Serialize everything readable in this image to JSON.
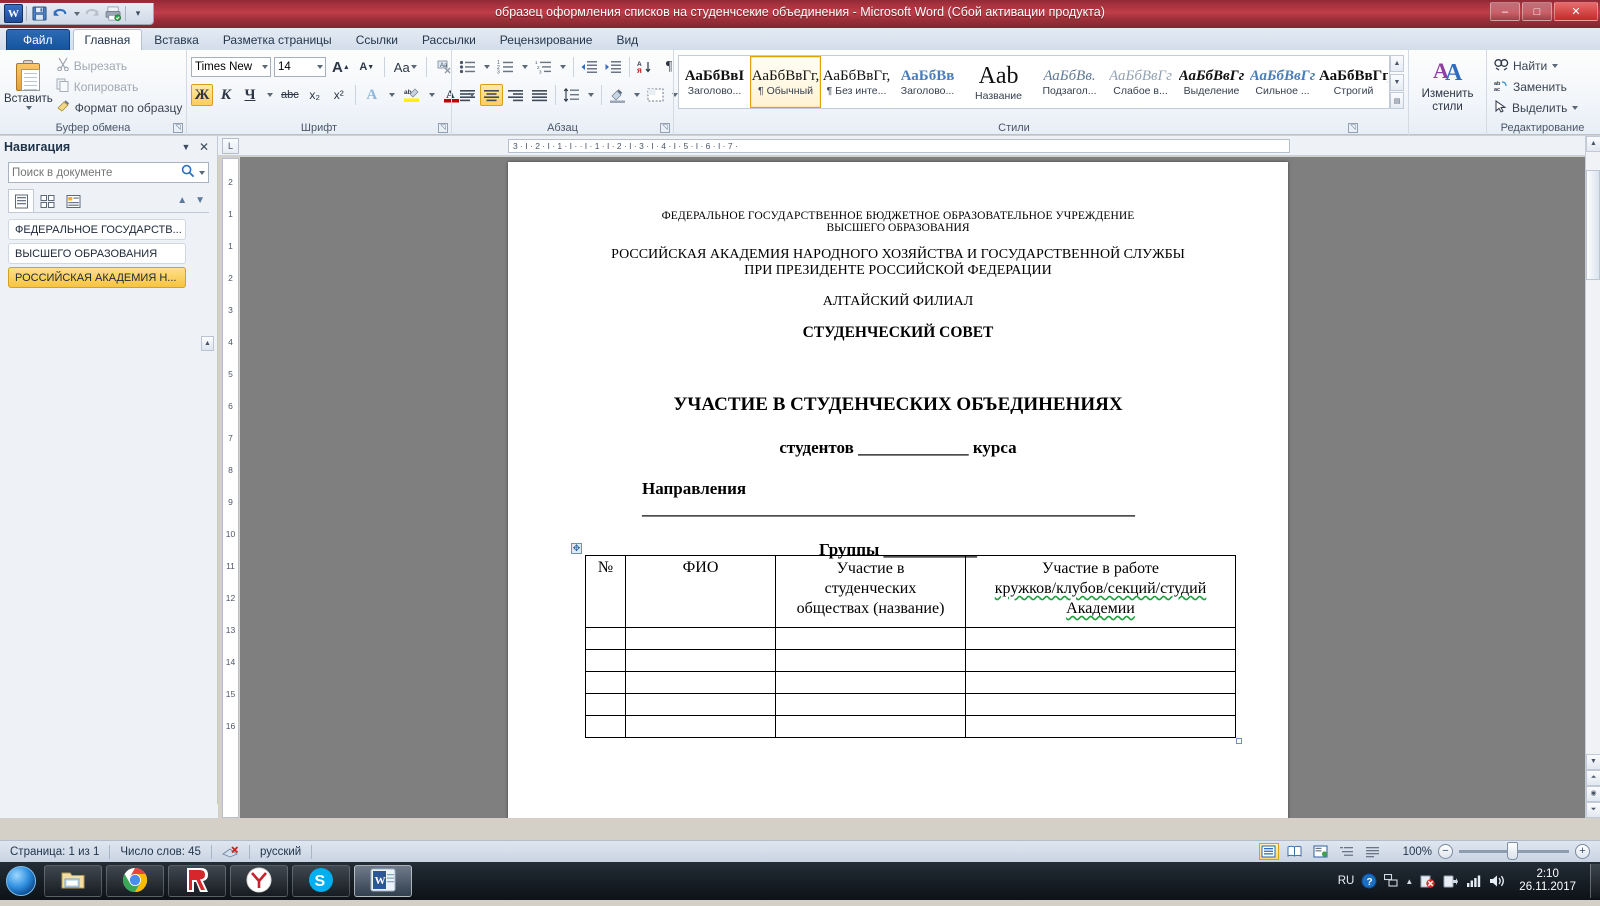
{
  "window": {
    "title": "образец оформления списков на студенчсекие объединения  -  Microsoft Word (Сбой активации продукта)",
    "minimize": "–",
    "maximize": "□",
    "close": "✕"
  },
  "qat": {
    "word_logo": "W",
    "save": "save-icon",
    "undo": "↺",
    "redo": "↻",
    "print": "print-icon",
    "more": "▾"
  },
  "tabs": [
    {
      "label": "Файл",
      "kind": "file"
    },
    {
      "label": "Главная",
      "kind": "active"
    },
    {
      "label": "Вставка",
      "kind": "normal"
    },
    {
      "label": "Разметка страницы",
      "kind": "normal"
    },
    {
      "label": "Ссылки",
      "kind": "normal"
    },
    {
      "label": "Рассылки",
      "kind": "normal"
    },
    {
      "label": "Рецензирование",
      "kind": "normal"
    },
    {
      "label": "Вид",
      "kind": "normal"
    }
  ],
  "ribbon": {
    "clipboard": {
      "group_label": "Буфер обмена",
      "paste": "Вставить",
      "cut": "Вырезать",
      "copy": "Копировать",
      "format_painter": "Формат по образцу"
    },
    "font": {
      "group_label": "Шрифт",
      "font_name": "Times New Rc",
      "font_size": "14",
      "grow": "A",
      "shrink": "A",
      "change_case": "Aa",
      "clear_formatting": "clear-format-icon",
      "bold": "Ж",
      "italic": "К",
      "underline": "Ч",
      "strikethrough": "abc",
      "subscript": "x₂",
      "superscript": "x²",
      "text_effects": "A",
      "highlight": "ab",
      "font_color": "A"
    },
    "paragraph": {
      "group_label": "Абзац",
      "bullets": "bullets-icon",
      "numbering": "numbering-icon",
      "multilevel": "multilevel-icon",
      "decrease_indent": "decrease-indent-icon",
      "increase_indent": "increase-indent-icon",
      "sort": "sort-icon",
      "show_marks": "¶",
      "align_left": "align-left-icon",
      "align_center": "align-center-icon",
      "align_right": "align-right-icon",
      "justify": "justify-icon",
      "line_spacing": "line-spacing-icon",
      "shading": "shading-icon",
      "borders": "borders-icon"
    },
    "styles": {
      "group_label": "Стили",
      "items": [
        {
          "preview": "АаБбВвI",
          "name": "Заголово..."
        },
        {
          "preview": "АаБбВвГг,",
          "name": "¶ Обычный",
          "selected": true
        },
        {
          "preview": "АаБбВвГг,",
          "name": "¶ Без инте..."
        },
        {
          "preview": "АаБбВв",
          "name": "Заголово..."
        },
        {
          "preview": "Aab",
          "name": "Название"
        },
        {
          "preview": "АаБбВв.",
          "name": "Подзагол..."
        },
        {
          "preview": "АаБбВвГг",
          "name": "Слабое в..."
        },
        {
          "preview": "АаБбВвГг",
          "name": "Выделение"
        },
        {
          "preview": "АаБбВвГг",
          "name": "Сильное ..."
        },
        {
          "preview": "АаБбВвГг,",
          "name": "Строгий"
        }
      ],
      "change_styles": "Изменить\nстили"
    },
    "change_styles_line1": "Изменить",
    "change_styles_line2": "стили",
    "editing": {
      "group_label": "Редактирование",
      "find": "Найти",
      "replace": "Заменить",
      "select": "Выделить"
    }
  },
  "navigation": {
    "title": "Навигация",
    "search_placeholder": "Поиск в документе",
    "search_value": "",
    "search_icon": "search-icon",
    "tab_headings": "headings-icon",
    "tab_pages": "pages-icon",
    "tab_results": "results-icon",
    "prev": "▲",
    "next": "▼",
    "items": [
      {
        "label": "ФЕДЕРАЛЬНОЕ ГОСУДАРСТВ...",
        "selected": false
      },
      {
        "label": "ВЫСШЕГО ОБРАЗОВАНИЯ",
        "selected": false
      },
      {
        "label": "РОССИЙСКАЯ АКАДЕМИЯ Н...",
        "selected": true
      }
    ]
  },
  "ruler": {
    "corner_marker": "L",
    "horizontal": "3  ·  I  ·  2  ·  I  ·  1  ·  I  ·   ·  I  ·  1  ·  I  ·  2  ·  I  ·  3  ·  I  ·  4  ·  I  ·  5  ·  I  ·  6  ·  I  ·  7  ·",
    "vertical": [
      "2",
      "1",
      "1",
      "2",
      "3",
      "4",
      "5",
      "6",
      "7",
      "8",
      "9",
      "10",
      "11",
      "12",
      "13",
      "14",
      "15",
      "16"
    ]
  },
  "document": {
    "header_lines": [
      "ФЕДЕРАЛЬНОЕ ГОСУДАРСТВЕННОЕ БЮДЖЕТНОЕ ОБРАЗОВАТЕЛЬНОЕ УЧРЕЖДЕНИЕ",
      "ВЫСШЕГО ОБРАЗОВАНИЯ"
    ],
    "academy_lines": [
      "РОССИЙСКАЯ АКАДЕМИЯ НАРОДНОГО ХОЗЯЙСТВА  И  ГОСУДАРСТВЕННОЙ СЛУЖБЫ",
      "ПРИ ПРЕЗИДЕНТЕ РОССИЙСКОЙ ФЕДЕРАЦИИ"
    ],
    "branch": "АЛТАЙСКИЙ ФИЛИАЛ",
    "council": "СТУДЕНЧЕСКИЙ СОВЕТ",
    "title": "УЧАСТИЕ В СТУДЕНЧЕСКИХ ОБЪЕДИНЕНИЯХ",
    "students_prefix": "студентов",
    "students_blank": "_____________",
    "students_suffix": "курса",
    "direction_label": "Направления",
    "direction_blank": "__________________________________________________________",
    "group_label": "Группы",
    "group_blank": "___________",
    "table": {
      "handle": "table-move-handle",
      "headers": [
        "№",
        "ФИО",
        "Участие в студенческих обществах (название)",
        "Участие в работе кружков/клубов/секций/студий Академии"
      ],
      "header_col3_lines": [
        "Участие в",
        "студенческих",
        "обществах (название)"
      ],
      "header_col4_lines": [
        "Участие в работе",
        "кружков/клубов/секций/студий",
        "Академии"
      ],
      "empty_rows": 5
    }
  },
  "statusbar": {
    "page": "Страница: 1 из 1",
    "words": "Число слов: 45",
    "proofing_icon": "proofing-errors-icon",
    "language": "русский",
    "zoom_percent": "100%",
    "views": [
      "print-layout-icon",
      "full-screen-reading-icon",
      "web-layout-icon",
      "outline-icon",
      "draft-icon"
    ],
    "zoom_out": "−",
    "zoom_in": "+"
  },
  "taskbar": {
    "start": "start-orb-icon",
    "items": [
      {
        "name": "explorer-icon",
        "glyph": "📁",
        "active": false
      },
      {
        "name": "chrome-icon",
        "glyph": "",
        "active": false
      },
      {
        "name": "yandex-icon",
        "glyph": "Я",
        "active": false
      },
      {
        "name": "yandex-browser-icon",
        "glyph": "Y",
        "active": false
      },
      {
        "name": "skype-icon",
        "glyph": "S",
        "active": false
      },
      {
        "name": "word-taskbar-icon",
        "glyph": "W",
        "active": true
      }
    ],
    "tray": {
      "language": "RU",
      "help": "?",
      "network_panel": "network-panel-icon",
      "expand": "▲",
      "antivirus": "antivirus-icon",
      "power": "power-icon",
      "signal": "signal-icon",
      "volume": "volume-icon",
      "time": "2:10",
      "date": "26.11.2017"
    }
  },
  "colors": {
    "title_bar": "#a8323d",
    "accent_gold": "#f6c440",
    "file_tab_blue": "#14539f",
    "spell_green": "#19a03a"
  }
}
